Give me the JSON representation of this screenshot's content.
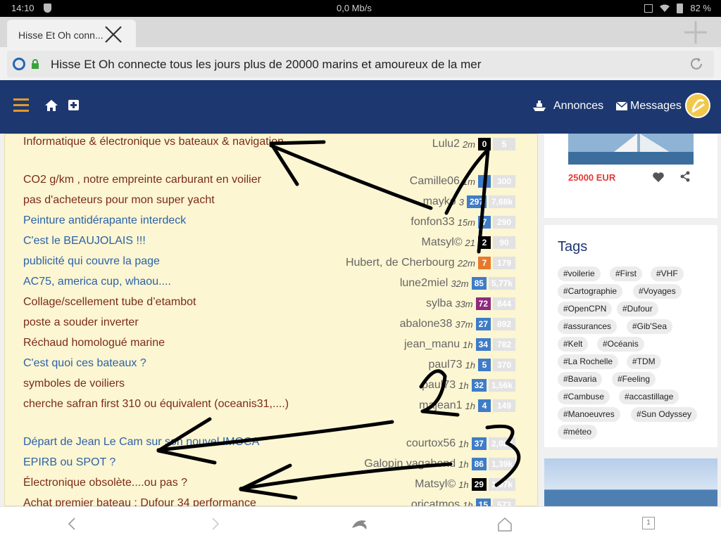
{
  "status_bar": {
    "time": "14:10",
    "network": "0,0 Mb/s",
    "battery": "82 %"
  },
  "browser": {
    "tab_title": "Hisse Et Oh conn...",
    "url_text": "Hisse Et Oh connecte tous les jours plus de 20000 marins et amoureux de la mer"
  },
  "site_nav": {
    "annonces_label": "Annonces",
    "messages_label": "Messages"
  },
  "topics": [
    {
      "title": "Informatique & électronique vs bateaux & navigation",
      "author": "Lulu2",
      "age": "2m",
      "count": "0",
      "views": "5",
      "badge_color": "#000000",
      "style": "bold"
    },
    {
      "title": "CO2 g/km , notre empreinte carburant en voilier",
      "author": "Camille06",
      "age": "1m",
      "count": "",
      "views": "300",
      "badge_color": "#3f7cc8",
      "style": "bold"
    },
    {
      "title": "pas d'acheteurs pour mon super yacht",
      "author": "mayko",
      "age": "3",
      "count": "297",
      "views": "7,68k",
      "badge_color": "#3f7cc8",
      "style": "bold"
    },
    {
      "title": "Peinture antidérapante interdeck",
      "author": "fonfon33",
      "age": "15m",
      "count": "7",
      "views": "290",
      "badge_color": "#3f7cc8",
      "style": "blue"
    },
    {
      "title": "C'est le BEAUJOLAIS !!!",
      "author": "Matsyl©",
      "age": "21",
      "count": "2",
      "views": "90",
      "badge_color": "#000000",
      "style": "blue"
    },
    {
      "title": "publicité qui couvre la page",
      "author": "Hubert, de Cherbourg",
      "age": "22m",
      "count": "7",
      "views": "179",
      "badge_color": "#e8792b",
      "style": "blue"
    },
    {
      "title": "AC75, america cup, whaou....",
      "author": "lune2miel",
      "age": "32m",
      "count": "85",
      "views": "5,77k",
      "badge_color": "#3f7cc8",
      "style": "blue"
    },
    {
      "title": "Collage/scellement tube d’etambot",
      "author": "sylba",
      "age": "33m",
      "count": "72",
      "views": "844",
      "badge_color": "#8e2a7e",
      "style": "bold"
    },
    {
      "title": "poste a souder inverter",
      "author": "abalone38",
      "age": "37m",
      "count": "27",
      "views": "892",
      "badge_color": "#3f7cc8",
      "style": "bold"
    },
    {
      "title": "Réchaud homologué marine",
      "author": "jean_manu",
      "age": "1h",
      "count": "34",
      "views": "782",
      "badge_color": "#3f7cc8",
      "style": "bold"
    },
    {
      "title": "C'est quoi ces bateaux ?",
      "author": "paul73",
      "age": "1h",
      "count": "5",
      "views": "370",
      "badge_color": "#3f7cc8",
      "style": "blue"
    },
    {
      "title": "symboles de voiliers",
      "author": "paul73",
      "age": "1h",
      "count": "32",
      "views": "1,56k",
      "badge_color": "#3f7cc8",
      "style": "bold"
    },
    {
      "title": "cherche safran first 310 ou équivalent (oceanis31,....)",
      "author": "majean1",
      "age": "1h",
      "count": "4",
      "views": "149",
      "badge_color": "#3f7cc8",
      "style": "bold"
    },
    {
      "title": "Départ de Jean Le Cam sur son nouvel IMOCA",
      "author": "courtox56",
      "age": "1h",
      "count": "37",
      "views": "2,08k",
      "badge_color": "#3f7cc8",
      "style": "blue"
    },
    {
      "title": "EPIRB ou SPOT ?",
      "author": "Galopin vagabond",
      "age": "1h",
      "count": "86",
      "views": "1,39k",
      "badge_color": "#3f7cc8",
      "style": "blue"
    },
    {
      "title": "Électronique obsolète....ou pas ?",
      "author": "Matsyl©",
      "age": "1h",
      "count": "29",
      "views": "1,07k",
      "badge_color": "#000000",
      "style": "bold"
    },
    {
      "title": "Achat premier bateau : Dufour 34 performance",
      "author": "oricatmos",
      "age": "1h",
      "count": "15",
      "views": "573",
      "badge_color": "#3f7cc8",
      "style": "bold"
    }
  ],
  "ad": {
    "price": "25000 EUR"
  },
  "tags": {
    "title": "Tags",
    "items": [
      "#voilerie",
      "#First",
      "#VHF",
      "#Cartographie",
      "#Voyages",
      "#OpenCPN",
      "#Dufour",
      "#assurances",
      "#Gib'Sea",
      "#Kelt",
      "#Océanis",
      "#La Rochelle",
      "#TDM",
      "#Bavaria",
      "#Feeling",
      "#Cambuse",
      "#accastillage",
      "#Manoeuvres",
      "#Sun Odyssey",
      "#méteo"
    ]
  },
  "bottom_bar": {
    "tab_count": "1"
  },
  "annotations": [
    "1",
    "2",
    "3"
  ],
  "colors": {
    "nav_bg": "#1d3870",
    "panel_bg": "#fcf6d2",
    "accent_orange": "#e39b26",
    "price_red": "#e53935"
  }
}
